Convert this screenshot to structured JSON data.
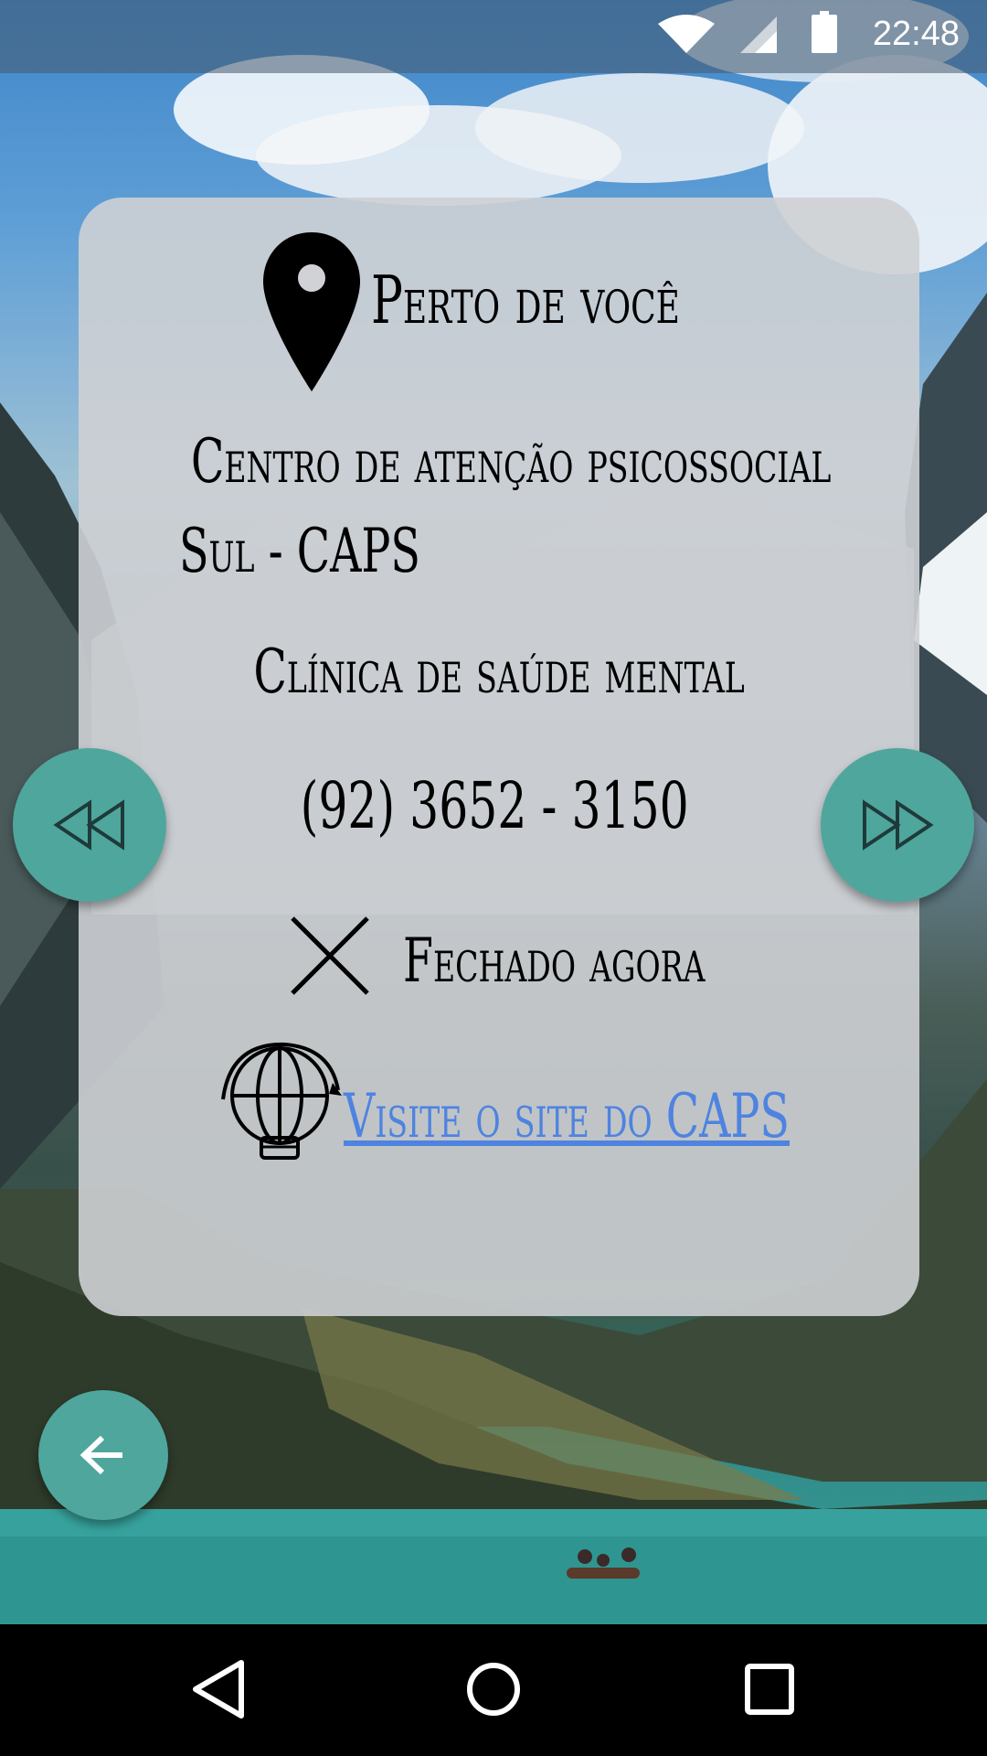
{
  "status_bar": {
    "time": "22:48",
    "icons": [
      "wifi-icon",
      "cellular-signal-icon",
      "battery-icon"
    ]
  },
  "card": {
    "title": "Perto de você",
    "place_name_line1": "Centro de atenção psicossocial",
    "place_name_line2": "Sul - CAPS",
    "category": "Clínica de saúde mental",
    "phone": "(92) 3652 - 3150",
    "open_status": "Fechado agora",
    "website_link": "Visite o site do CAPS",
    "link_color": "#4e83e0"
  },
  "buttons": {
    "previous": "rewind-icon",
    "next": "fast-forward-icon",
    "back": "arrow-left-icon",
    "accent_color": "#4fa69c"
  },
  "nav_bar": {
    "items": [
      "back-triangle-icon",
      "home-circle-icon",
      "recents-square-icon"
    ]
  }
}
